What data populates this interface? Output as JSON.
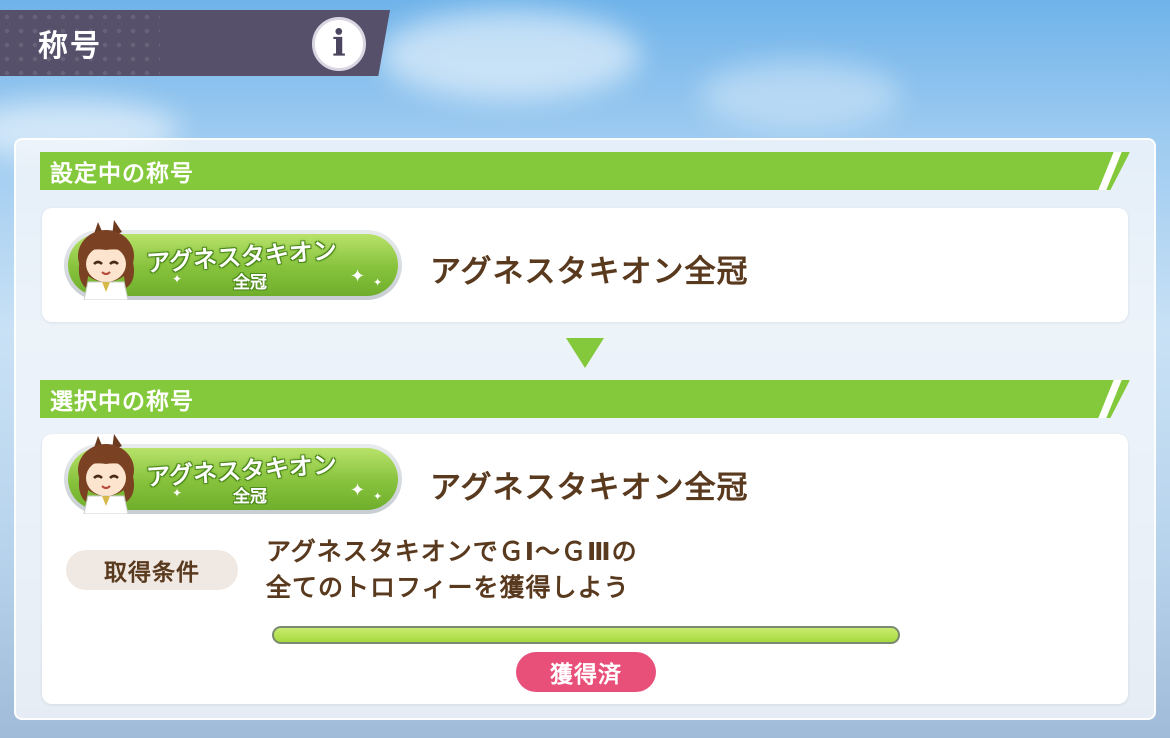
{
  "header": {
    "title": "称号",
    "info_icon": "info-icon",
    "info_glyph": "i"
  },
  "current_section": {
    "label": "設定中の称号",
    "badge": {
      "line1": "アグネスタキオン",
      "line2": "全冠"
    },
    "title_name": "アグネスタキオン全冠"
  },
  "selected_section": {
    "label": "選択中の称号",
    "badge": {
      "line1": "アグネスタキオン",
      "line2": "全冠"
    },
    "title_name": "アグネスタキオン全冠",
    "condition_label": "取得条件",
    "condition_line1": "アグネスタキオンでＧⅠ～ＧⅢの",
    "condition_line2": "全てのトロフィーを獲得しよう",
    "progress": 1.0,
    "status": "獲得済"
  },
  "colors": {
    "accent_green": "#84c93c",
    "header_bg": "#56506a",
    "text_brown": "#5a3a1e",
    "status_pink": "#e8507a"
  }
}
